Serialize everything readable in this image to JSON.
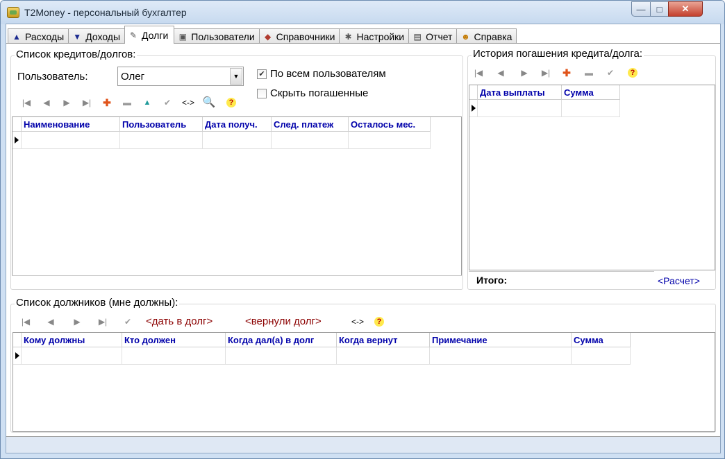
{
  "window": {
    "title": "T2Money - персональный бухгалтер",
    "controls": {
      "minimize": "—",
      "maximize": "□",
      "close": "✕"
    }
  },
  "tabs": [
    {
      "label": "Расходы",
      "icon": "arrow-up-icon"
    },
    {
      "label": "Доходы",
      "icon": "arrow-down-icon"
    },
    {
      "label": "Долги",
      "icon": "notepad-icon"
    },
    {
      "label": "Пользователи",
      "icon": "user-card-icon"
    },
    {
      "label": "Справочники",
      "icon": "book-icon"
    },
    {
      "label": "Настройки",
      "icon": "settings-icon"
    },
    {
      "label": "Отчет",
      "icon": "report-icon"
    },
    {
      "label": "Справка",
      "icon": "help-person-icon"
    }
  ],
  "active_tab": "Долги",
  "credits": {
    "title": "Список кредитов/долгов:",
    "user_label": "Пользователь:",
    "user_value": "Олег",
    "all_users_label": "По всем пользователям",
    "all_users_checked": true,
    "hide_paid_label": "Скрыть погашенные",
    "hide_paid_checked": false,
    "toolbar": {
      "first": "|◀",
      "prev": "◀",
      "next": "▶",
      "last": "▶|",
      "add": "✚",
      "delete": "▬",
      "up": "▲",
      "post": "✔",
      "swap": "<->",
      "find": "🔍",
      "help": "?"
    },
    "columns": [
      "Наименование",
      "Пользователь",
      "Дата получ.",
      "След. платеж",
      "Осталось мес."
    ]
  },
  "history": {
    "title": "История погашения кредита/долга:",
    "toolbar": {
      "first": "|◀",
      "prev": "◀",
      "next": "▶",
      "last": "▶|",
      "add": "✚",
      "delete": "▬",
      "post": "✔",
      "help": "?"
    },
    "columns": [
      "Дата выплаты",
      "Сумма"
    ],
    "total_label": "Итого:",
    "calc_link": "<Расчет>"
  },
  "debtors": {
    "title": "Список должников (мне должны):",
    "toolbar": {
      "first": "|◀",
      "prev": "◀",
      "next": "▶",
      "last": "▶|",
      "post": "✔",
      "swap": "<->",
      "help": "?"
    },
    "give_link": "<дать в долг>",
    "returned_link": "<вернули долг>",
    "columns": [
      "Кому должны",
      "Кто должен",
      "Когда дал(а) в долг",
      "Когда вернут",
      "Примечание",
      "Сумма"
    ]
  },
  "colors": {
    "header_text": "#0000aa",
    "link_text": "#8b0000",
    "frame": "#cfe0f3"
  }
}
